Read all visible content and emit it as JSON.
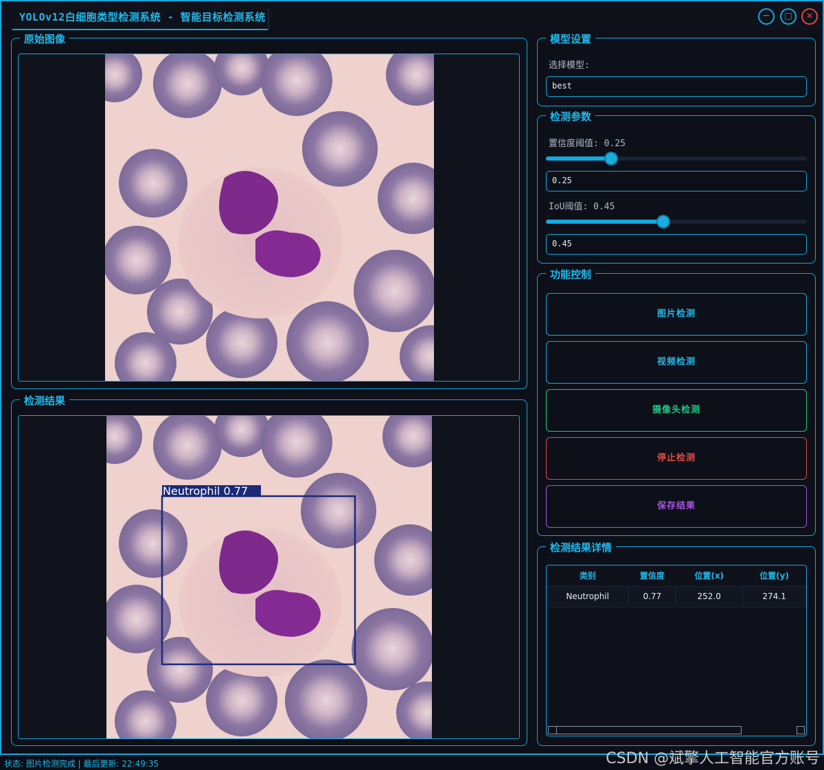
{
  "window": {
    "title": "YOLOv12白细胞类型检测系统 - 智能目标检测系统",
    "minimize_symbol": "−",
    "maximize_symbol": "□",
    "close_symbol": "✕"
  },
  "original": {
    "title": "原始图像"
  },
  "result": {
    "title": "检测结果",
    "box_label": "Neutrophil 0.77",
    "box_color": "#1a2a78"
  },
  "model": {
    "title": "模型设置",
    "select_label": "选择模型:",
    "select_value": "best"
  },
  "params": {
    "title": "检测参数",
    "conf_label": "置信度阈值: 0.25",
    "conf_value": "0.25",
    "conf_fraction": 0.25,
    "iou_label": "IoU阈值: 0.45",
    "iou_value": "0.45",
    "iou_fraction": 0.45
  },
  "controls": {
    "title": "功能控制",
    "image_detect": "图片检测",
    "video_detect": "视频检测",
    "camera_detect": "摄像头检测",
    "stop_detect": "停止检测",
    "save_result": "保存结果",
    "colors": {
      "image": "#12a9e0",
      "video": "#12a9e0",
      "camera": "#1ec98a",
      "stop": "#e04a4a",
      "save": "#a455e0"
    }
  },
  "details": {
    "title": "检测结果详情",
    "columns": [
      "类别",
      "置信度",
      "位置(x)",
      "位置(y)"
    ],
    "rows": [
      [
        "Neutrophil",
        "0.77",
        "252.0",
        "274.1"
      ]
    ]
  },
  "status": "状态: 图片检测完成 | 最后更新: 22:49:35",
  "watermark": "CSDN @斌擎人工智能官方账号"
}
